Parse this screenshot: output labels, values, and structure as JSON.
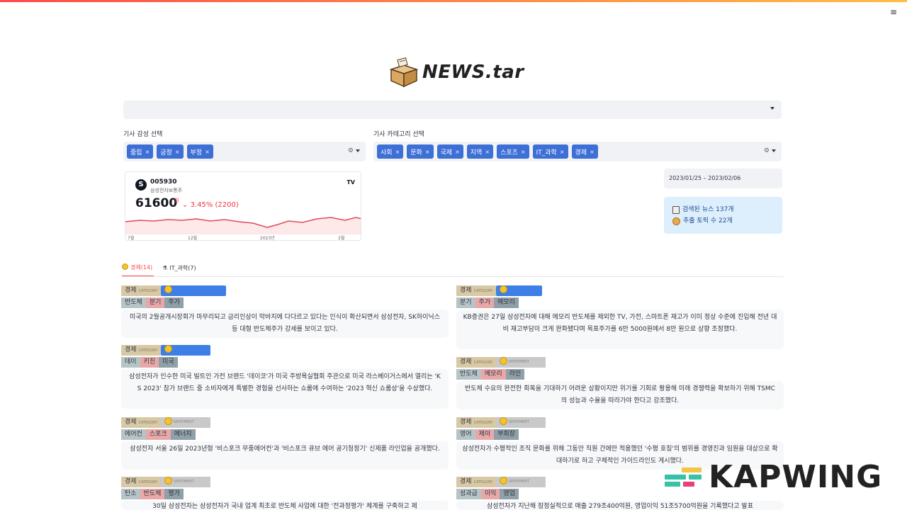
{
  "app": {
    "title": "NEWS.tar",
    "menu_icon": "hamburger-icon"
  },
  "filters": {
    "sentiment_label": "기사 감성 선택",
    "sentiment_chips": [
      "중립",
      "긍정",
      "부정"
    ],
    "category_label": "기사 카테고리 선택",
    "category_chips": [
      "사회",
      "문화",
      "국제",
      "지역",
      "스포츠",
      "IT_과학",
      "경제"
    ],
    "chip_remove": "×"
  },
  "stock": {
    "code": "005930",
    "name": "삼성전자보통주",
    "price": "61600",
    "unit": "원",
    "change": "⌄ 3.45% (2200)",
    "ticks": [
      "7월",
      "12월",
      "2023년",
      "2월"
    ],
    "brand": "TV"
  },
  "date_range": "2023/01/25 – 2023/02/06",
  "summary": {
    "news_count": "검색된 뉴스 137개",
    "topic_count": "추출 토픽 수 22개"
  },
  "tabs": [
    {
      "label": "경제(14)",
      "active": true
    },
    {
      "label": "IT_과학(7)",
      "active": false
    }
  ],
  "cards": [
    {
      "category": "경제",
      "cat_small": "CATEGORY",
      "sentiment": "positive",
      "keywords": [
        "반도체",
        "분기",
        "주가"
      ],
      "text": "미국의 2월공개시장회가 마무리되고 금리인상이 막바지에 다다르고 있다는 인식이 확산되면서 삼성전자, SK하이닉스 등 대형 반도체주가 강세를 보이고 있다."
    },
    {
      "category": "경제",
      "cat_small": "CATEGORY",
      "sentiment": "positive",
      "keywords": [
        "분기",
        "주가",
        "메모리"
      ],
      "text": "KB증권은 27일 삼성전자에 대해 메모리 반도체를 제외한 TV, 가전, 스마트폰 재고가 이미 정상 수준에 진입해 전년 대비 재고부담이 크게 완화됐다며 목표주가를 6만 5000원에서 8만 원으로 상향 조정했다."
    },
    {
      "category": "경제",
      "cat_small": "CATEGORY",
      "sentiment": "positive",
      "keywords": [
        "데이",
        "키친",
        "미국"
      ],
      "text": "삼성전자가 인수한 미국 빌트인 가전 브랜드 '데이코'가 미국 주방욕실협회 주관으로 미국 라스베이거스에서 열리는 'K S 2023' 참가 브랜드 중 소비자에게 특별한 경험을 선사하는 쇼룸에 수여하는 '2023 혁신 쇼룸상'을 수상했다."
    },
    {
      "category": "경제",
      "cat_small": "CATEGORY",
      "sentiment": "neutral",
      "sent_small": "SENTIMENT",
      "keywords": [
        "반도체",
        "메모리",
        "라인"
      ],
      "text": "반도체 수요의 완전한 회복을 기대하기 어려운 상황이지만 위기를 기회로 활용해 미래 경쟁력을 확보하기 위해 TSMC의 성능과 수율을 따라가야 한다고 강조했다."
    },
    {
      "category": "경제",
      "cat_small": "CATEGORY",
      "sentiment": "neutral",
      "sent_small": "SENTIMENT",
      "keywords": [
        "에어컨",
        "스포크",
        "에너지"
      ],
      "text": "삼성전자 서울 26일 2023년형 '비스포크 무풍에어컨'과 '비스포크 큐브 에어 공기청정기' 신제품 라인업을 공개했다."
    },
    {
      "category": "경제",
      "cat_small": "CATEGORY",
      "sentiment": "neutral",
      "sent_small": "SENTIMENT",
      "keywords": [
        "영어",
        "제이",
        "부회장"
      ],
      "text": "삼성전자가 수평적인 조직 문화를 위해 그동안 직원 간에만 적용했던 '수평 호칭'의 범위를 경영진과 임원을 대상으로 확대하기로 하고 구체적인 가이드라인도 게시했다."
    },
    {
      "category": "경제",
      "cat_small": "CATEGORY",
      "sentiment": "neutral",
      "sent_small": "SENTIMENT",
      "keywords": [
        "탄소",
        "반도체",
        "평가"
      ],
      "text": "30일 삼성전자는 삼성전자가 국내 업계 최초로 반도체 사업에 대한 '전과정평가' 체계를 구축하고 제"
    },
    {
      "category": "경제",
      "cat_small": "CATEGORY",
      "sentiment": "neutral",
      "sent_small": "SENTIMENT",
      "keywords": [
        "성과급",
        "이익",
        "영업"
      ],
      "text": "삼성전자가 지난해 잠정실적으로 매출 279조400억원, 영업이익 51조5700억원을 기록했다고 발표"
    }
  ],
  "watermark": "KAPWING"
}
